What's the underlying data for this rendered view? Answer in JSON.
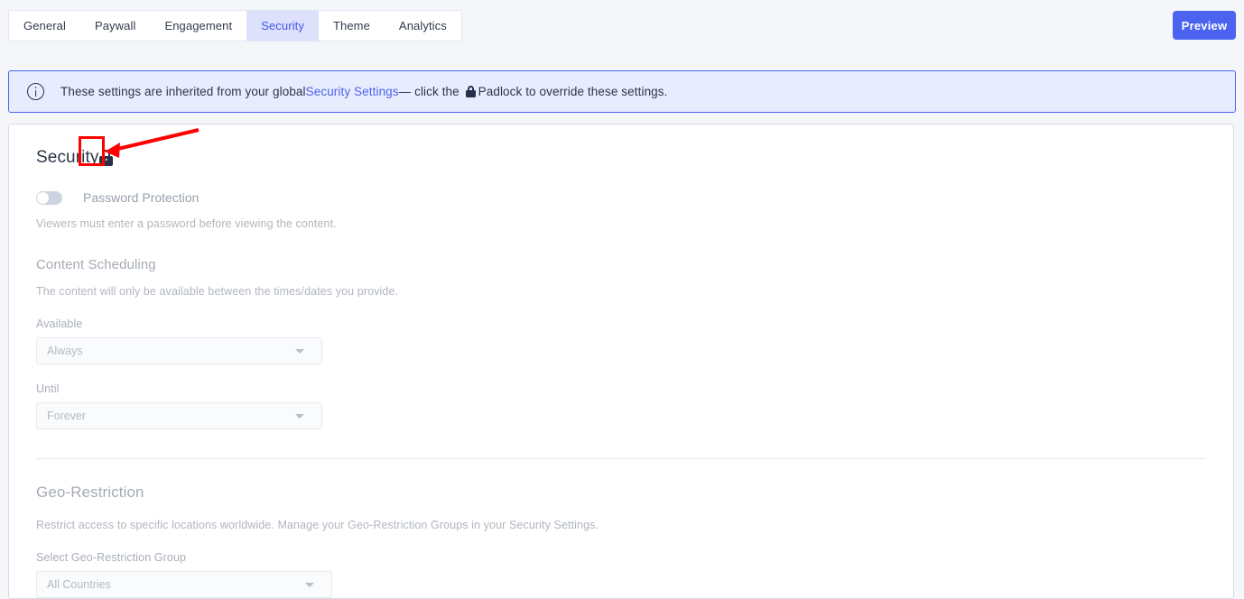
{
  "tabs": [
    {
      "label": "General",
      "active": false
    },
    {
      "label": "Paywall",
      "active": false
    },
    {
      "label": "Engagement",
      "active": false
    },
    {
      "label": "Security",
      "active": true
    },
    {
      "label": "Theme",
      "active": false
    },
    {
      "label": "Analytics",
      "active": false
    }
  ],
  "header": {
    "preview_label": "Preview"
  },
  "banner": {
    "icon": "info-circle-icon",
    "text_before_link": "These settings are inherited from your global",
    "link_label": "Security Settings",
    "text_after_link": "— click the",
    "lock_icon": "padlock-icon",
    "text_end": "Padlock to override these settings."
  },
  "security_section": {
    "title": "Security",
    "lock_icon": "padlock-icon",
    "password_protection": {
      "toggle_state": "off",
      "label": "Password Protection",
      "help": "Viewers must enter a password before viewing the content."
    },
    "content_scheduling": {
      "heading": "Content Scheduling",
      "help": "The content will only be available between the times/dates you provide.",
      "available_label": "Available",
      "available_value": "Always",
      "until_label": "Until",
      "until_value": "Forever"
    }
  },
  "geo_restriction": {
    "heading": "Geo-Restriction",
    "help": "Restrict access to specific locations worldwide. Manage your Geo-Restriction Groups in your Security Settings.",
    "group_label": "Select Geo-Restriction Group",
    "group_value": "All Countries"
  },
  "annotation": {
    "highlight_target": "padlock-icon",
    "box_color": "#ff0000",
    "arrow_color": "#ff0000"
  },
  "colors": {
    "page_bg": "#f4f6fa",
    "accent": "#4b63ef",
    "active_tab_bg": "#dde1fb",
    "banner_bg": "#e9ecfd",
    "card_bg": "#ffffff",
    "muted_text": "#b1b6be"
  }
}
